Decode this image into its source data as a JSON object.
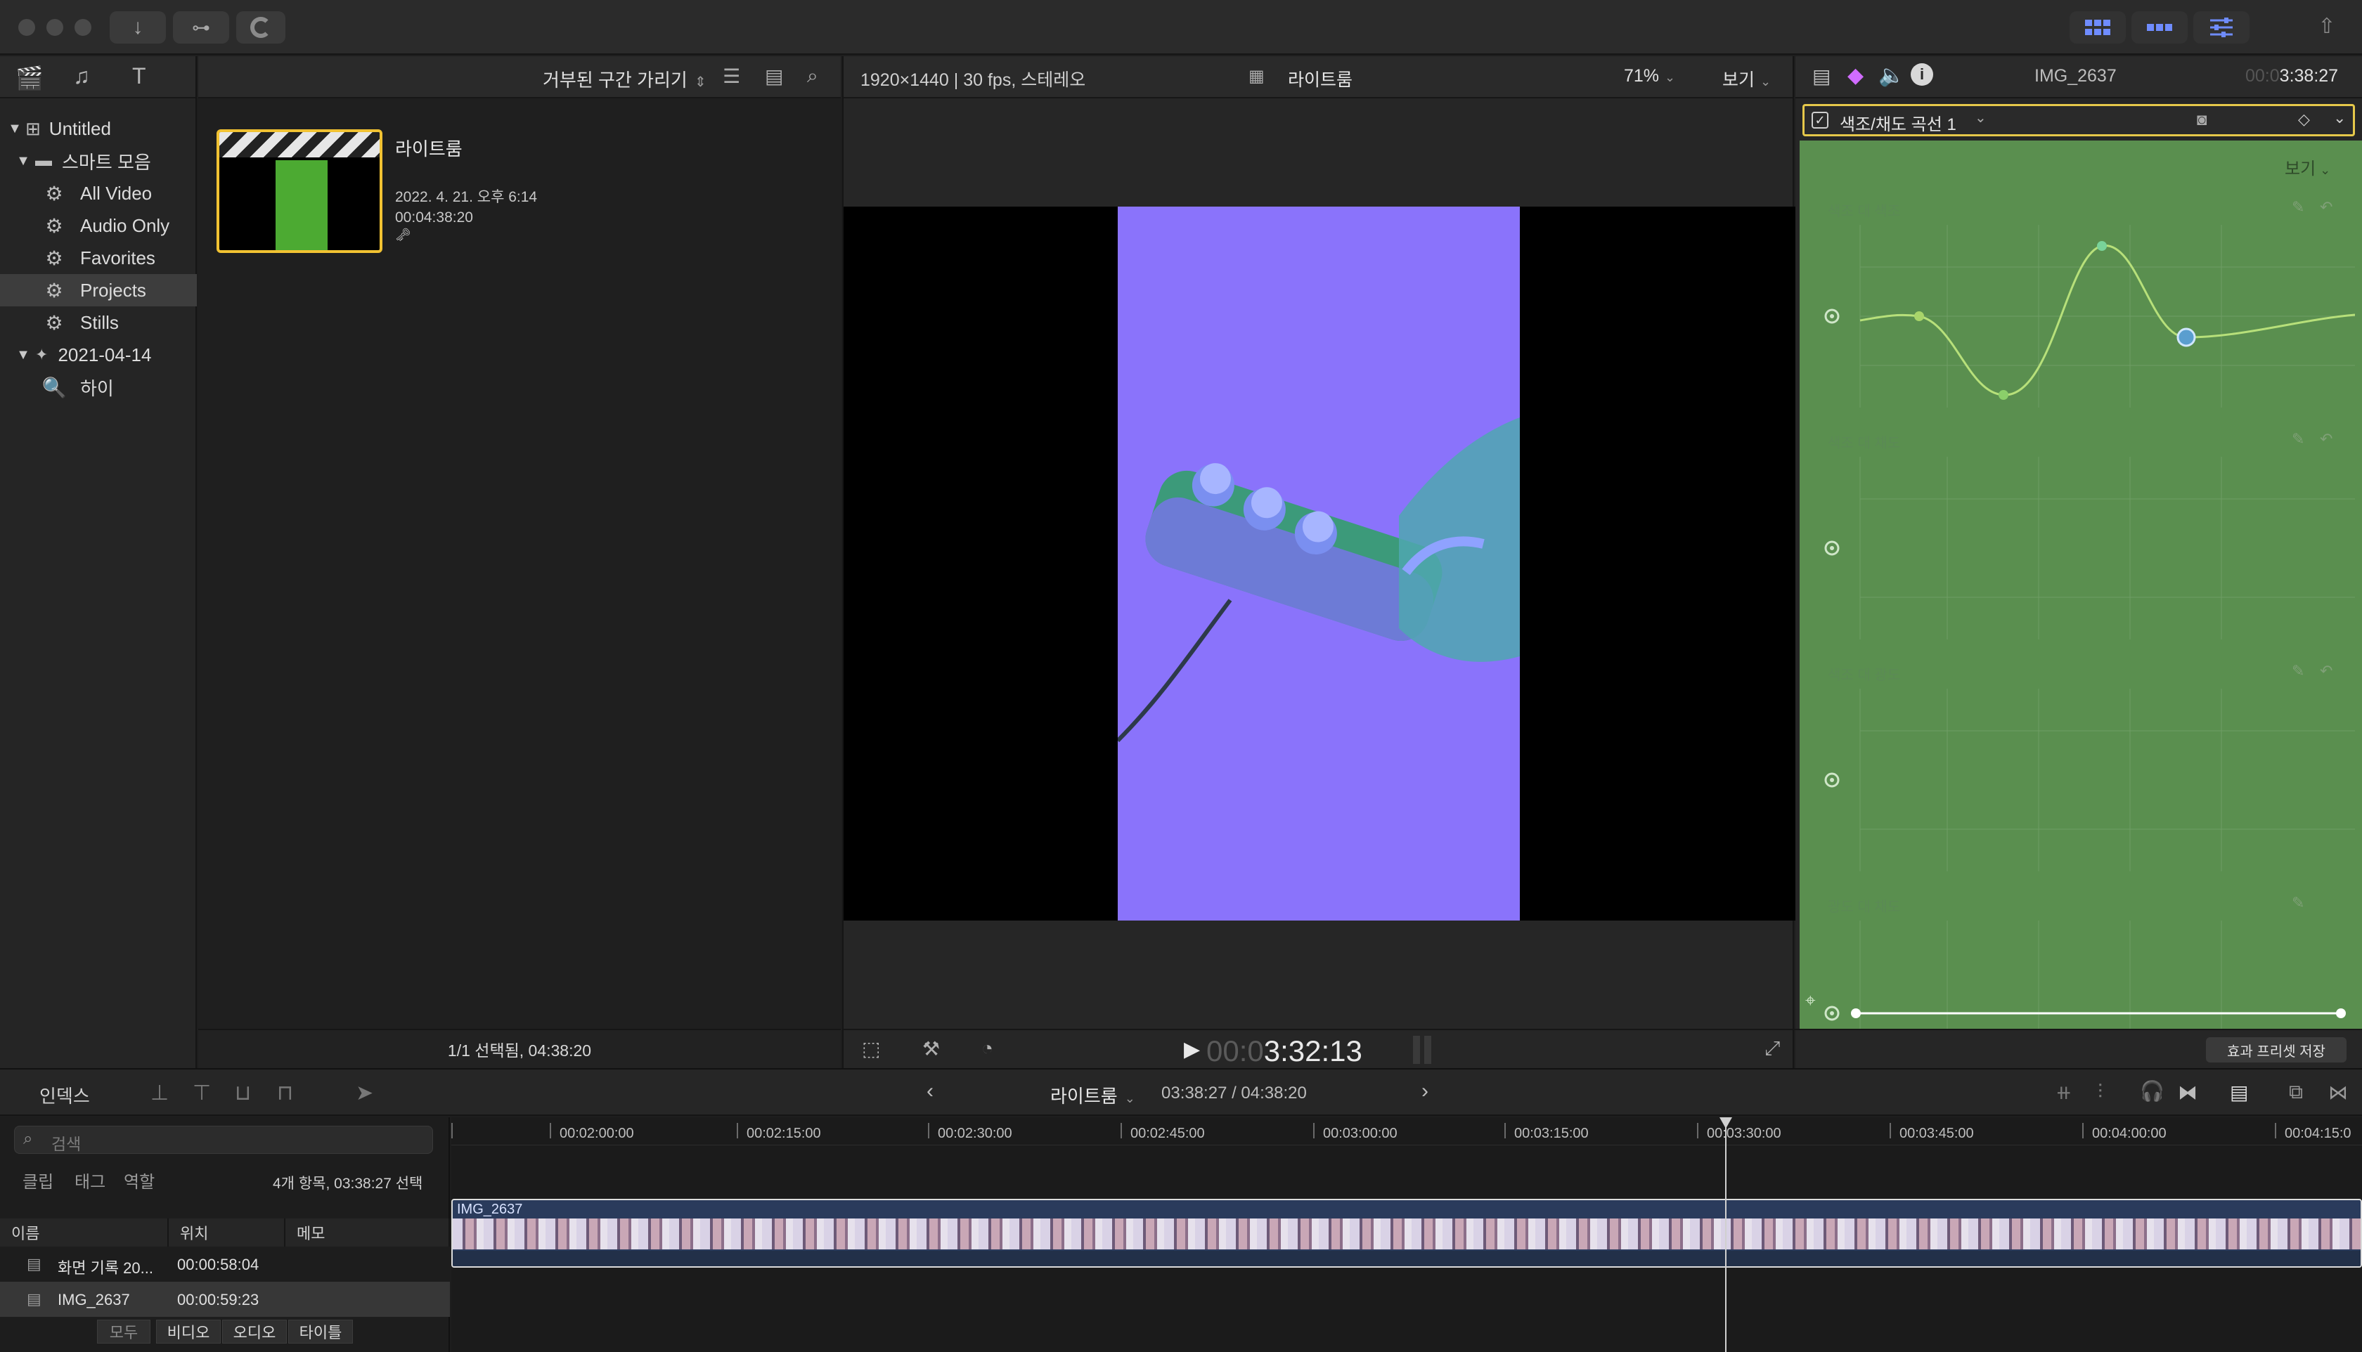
{
  "browser": {
    "filter_label": "거부된 구간 가리기",
    "clip": {
      "title": "라이트룸",
      "date": "2022. 4. 21. 오후 6:14",
      "duration": "00:04:38:20",
      "key_glyph": "🗝"
    },
    "status": "1/1 선택됨, 04:38:20"
  },
  "library": {
    "root": "Untitled",
    "smart_collection": "스마트 모음",
    "items": [
      "All Video",
      "Audio Only",
      "Favorites",
      "Projects",
      "Stills"
    ],
    "event": "2021-04-14",
    "keyword": "하이"
  },
  "viewer": {
    "format": "1920×1440 | 30 fps, 스테레오",
    "title": "라이트룸",
    "zoom": "71%",
    "view_menu": "보기",
    "timecode_dim": "00:0",
    "timecode": "3:32:13"
  },
  "inspector": {
    "clip_name": "IMG_2637",
    "duration_dim": "00:0",
    "duration": "3:38:27",
    "effect_name": "색조/채도 곡선 1",
    "view_menu": "보기",
    "curves": [
      "색조 대 색조",
      "색조 대 채도",
      "색조 대 광도",
      "광도 대 채도"
    ],
    "save_preset": "효과 프리셋 저장",
    "bg_color": "#5a8f4f"
  },
  "timeline_header": {
    "index_label": "인덱스",
    "project_name": "라이트룸",
    "time_range": "03:38:27 / 04:38:20"
  },
  "index": {
    "search_placeholder": "검색",
    "tabs": [
      "클립",
      "태그",
      "역할"
    ],
    "summary": "4개 항목, 03:38:27 선택",
    "columns": [
      "이름",
      "위치",
      "메모"
    ],
    "rows": [
      {
        "name": "화면 기록 20...",
        "position": "00:00:58:04"
      },
      {
        "name": "IMG_2637",
        "position": "00:00:59:23"
      }
    ],
    "filters": [
      "모두",
      "비디오",
      "오디오",
      "타이틀"
    ]
  },
  "timeline": {
    "ruler": [
      "00:02:00:00",
      "00:02:15:00",
      "00:02:30:00",
      "00:02:45:00",
      "00:03:00:00",
      "00:03:15:00",
      "00:03:30:00",
      "00:03:45:00",
      "00:04:00:00",
      "00:04:15:0"
    ],
    "clip_label": "IMG_2637"
  }
}
